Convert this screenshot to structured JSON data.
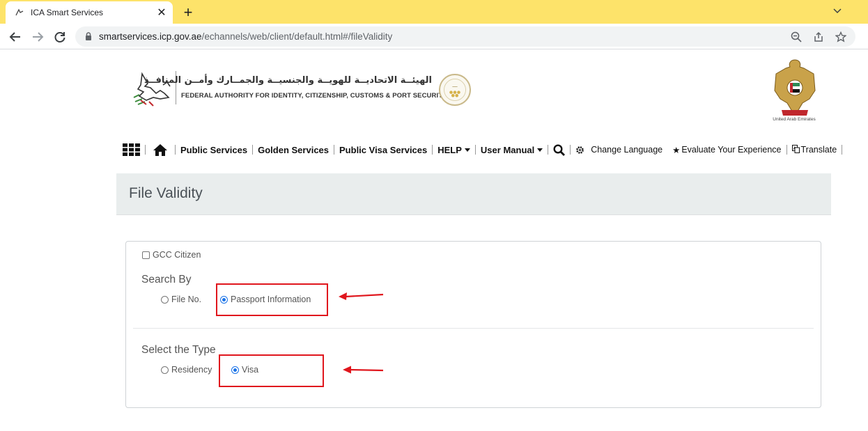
{
  "browser": {
    "tab_title": "ICA Smart Services",
    "url_host": "smartservices.icp.gov.ae",
    "url_path": "/echannels/web/client/default.html#/fileValidity"
  },
  "header": {
    "arabic_name": "الهيئــة الاتحاديــة للهويــة والجنسيــة والجمــارك وأمــن المنافــذ",
    "english_name": "FEDERAL AUTHORITY FOR IDENTITY, CITIZENSHIP, CUSTOMS & PORT SECURITY",
    "emblem_caption": "United Arab Emirates"
  },
  "nav": {
    "public_services": "Public Services",
    "golden_services": "Golden Services",
    "public_visa_services": "Public Visa Services",
    "help": "HELP",
    "user_manual": "User Manual",
    "change_language": "Change Language",
    "evaluate": "Evaluate Your Experience",
    "translate": "Translate"
  },
  "page": {
    "title": "File Validity"
  },
  "form": {
    "gcc_label": "GCC Citizen",
    "gcc_checked": false,
    "search_by_label": "Search By",
    "search_by_options": [
      "File No.",
      "Passport Information"
    ],
    "search_by_selected": "Passport Information",
    "type_label": "Select the Type",
    "type_options": [
      "Residency",
      "Visa"
    ],
    "type_selected": "Visa"
  },
  "colors": {
    "tabstrip": "#fde36a",
    "title_band": "#e9eded",
    "highlight": "#e0161d",
    "radio_checked": "#1a73e8"
  }
}
